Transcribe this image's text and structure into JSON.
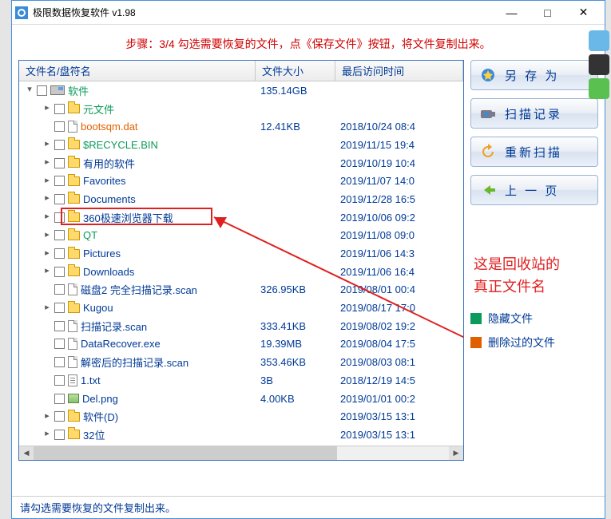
{
  "title": "极限数据恢复软件 v1.98",
  "step": "步骤：3/4 勾选需要恢复的文件，点《保存文件》按钮，将文件复制出来。",
  "headers": {
    "name": "文件名/盘符名",
    "size": "文件大小",
    "time": "最后访问时间"
  },
  "rows": [
    {
      "ind": 0,
      "tw": "▾",
      "ico": "drv",
      "name": "软件",
      "nc": "gr",
      "size": "135.14GB",
      "time": ""
    },
    {
      "ind": 1,
      "tw": "▸",
      "ico": "fld",
      "name": "元文件",
      "nc": "gr",
      "size": "",
      "time": ""
    },
    {
      "ind": 1,
      "tw": "",
      "ico": "fil",
      "name": "bootsqm.dat",
      "nc": "or",
      "size": "12.41KB",
      "time": "2018/10/24 08:4"
    },
    {
      "ind": 1,
      "tw": "▸",
      "ico": "fld",
      "name": "$RECYCLE.BIN",
      "nc": "gr",
      "size": "",
      "time": "2019/11/15 19:4"
    },
    {
      "ind": 1,
      "tw": "▸",
      "ico": "fld",
      "name": "有用的软件",
      "nc": "",
      "size": "",
      "time": "2019/10/19 10:4"
    },
    {
      "ind": 1,
      "tw": "▸",
      "ico": "fld",
      "name": "Favorites",
      "nc": "",
      "size": "",
      "time": "2019/11/07 14:0"
    },
    {
      "ind": 1,
      "tw": "▸",
      "ico": "fld",
      "name": "Documents",
      "nc": "",
      "size": "",
      "time": "2019/12/28 16:5"
    },
    {
      "ind": 1,
      "tw": "▸",
      "ico": "fld",
      "name": "360极速浏览器下载",
      "nc": "",
      "size": "",
      "time": "2019/10/06 09:2"
    },
    {
      "ind": 1,
      "tw": "▸",
      "ico": "fld",
      "name": "QT",
      "nc": "gr",
      "size": "",
      "time": "2019/11/08 09:0"
    },
    {
      "ind": 1,
      "tw": "▸",
      "ico": "fld",
      "name": "Pictures",
      "nc": "",
      "size": "",
      "time": "2019/11/06 14:3"
    },
    {
      "ind": 1,
      "tw": "▸",
      "ico": "fld",
      "name": "Downloads",
      "nc": "",
      "size": "",
      "time": "2019/11/06 16:4"
    },
    {
      "ind": 1,
      "tw": "",
      "ico": "fil",
      "name": "磁盘2 完全扫描记录.scan",
      "nc": "",
      "size": "326.95KB",
      "time": "2019/08/01 00:4"
    },
    {
      "ind": 1,
      "tw": "▸",
      "ico": "fld",
      "name": "Kugou",
      "nc": "",
      "size": "",
      "time": "2019/08/17 17:0"
    },
    {
      "ind": 1,
      "tw": "",
      "ico": "fil",
      "name": "扫描记录.scan",
      "nc": "",
      "size": "333.41KB",
      "time": "2019/08/02 19:2"
    },
    {
      "ind": 1,
      "tw": "",
      "ico": "fil",
      "name": "DataRecover.exe",
      "nc": "",
      "size": "19.39MB",
      "time": "2019/08/04 17:5"
    },
    {
      "ind": 1,
      "tw": "",
      "ico": "fil",
      "name": "解密后的扫描记录.scan",
      "nc": "",
      "size": "353.46KB",
      "time": "2019/08/03 08:1"
    },
    {
      "ind": 1,
      "tw": "",
      "ico": "txt",
      "name": "1.txt",
      "nc": "",
      "size": "3B",
      "time": "2018/12/19 14:5"
    },
    {
      "ind": 1,
      "tw": "",
      "ico": "png",
      "name": "Del.png",
      "nc": "",
      "size": "4.00KB",
      "time": "2019/01/01 00:2"
    },
    {
      "ind": 1,
      "tw": "▸",
      "ico": "fld",
      "name": "软件(D)",
      "nc": "",
      "size": "",
      "time": "2019/03/15 13:1"
    },
    {
      "ind": 1,
      "tw": "▸",
      "ico": "fld",
      "name": "32位",
      "nc": "",
      "size": "",
      "time": "2019/03/15 13:1"
    }
  ],
  "buttons": {
    "save": "另 存 为",
    "log": "扫描记录",
    "rescan": "重新扫描",
    "back": "上 一 页"
  },
  "annotation": {
    "l1": "这是回收站的",
    "l2": "真正文件名"
  },
  "legend": {
    "hidden": "隐藏文件",
    "deleted": "删除过的文件",
    "hidden_color": "#0a9a5a",
    "deleted_color": "#e06000"
  },
  "footer": "请勾选需要恢复的文件复制出来。",
  "winbtns": {
    "min": "—",
    "max": "□",
    "close": "✕"
  }
}
